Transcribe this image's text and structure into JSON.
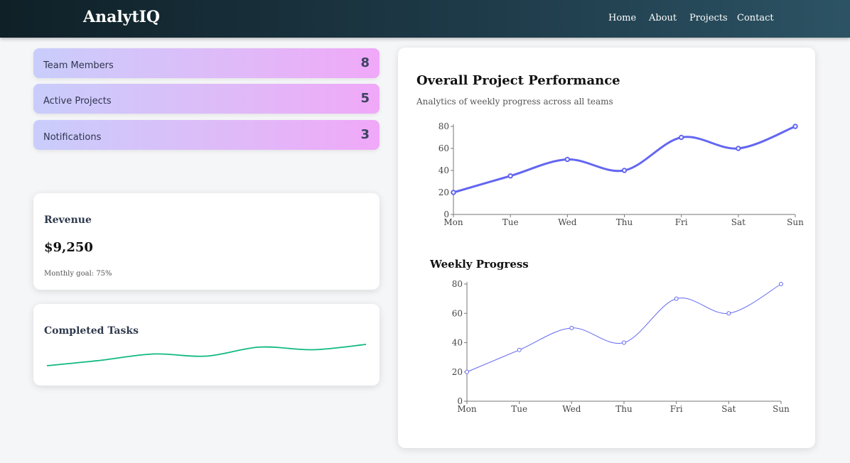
{
  "nav": {
    "brand": "AnalytIQ",
    "links": [
      "Home",
      "About",
      "Projects",
      "Contact"
    ]
  },
  "stats": [
    {
      "label": "Team Members",
      "value": "8"
    },
    {
      "label": "Active Projects",
      "value": "5"
    },
    {
      "label": "Notifications",
      "value": "3"
    }
  ],
  "revenue": {
    "title": "Revenue",
    "amount": "$9,250",
    "goal": "Monthly goal: 75%"
  },
  "tasks": {
    "title": "Completed Tasks"
  },
  "performance": {
    "title": "Overall Project Performance",
    "subtitle": "Analytics of weekly progress across all teams"
  },
  "weekly": {
    "title": "Weekly Progress"
  },
  "chart_data": [
    {
      "type": "line",
      "categories": [
        "Mon",
        "Tue",
        "Wed",
        "Thu",
        "Fri",
        "Sat",
        "Sun"
      ],
      "series": [
        {
          "values": [
            20,
            35,
            50,
            40,
            70,
            60,
            80
          ]
        }
      ],
      "ylim": [
        0,
        80
      ],
      "yticks": [
        0,
        20,
        40,
        60,
        80
      ],
      "color": "#6366f1",
      "grid": false
    },
    {
      "type": "line",
      "title": "Weekly Progress",
      "categories": [
        "Mon",
        "Tue",
        "Wed",
        "Thu",
        "Fri",
        "Sat",
        "Sun"
      ],
      "series": [
        {
          "values": [
            20,
            35,
            50,
            40,
            70,
            60,
            80
          ]
        }
      ],
      "ylim": [
        0,
        80
      ],
      "yticks": [
        0,
        20,
        40,
        60,
        80
      ],
      "color": "#6366f1",
      "grid": false
    },
    {
      "type": "line",
      "title": "Completed Tasks",
      "series": [
        {
          "values": [
            20,
            30,
            42,
            38,
            55,
            50,
            60
          ]
        }
      ],
      "color": "#10b981",
      "axes": false
    }
  ]
}
